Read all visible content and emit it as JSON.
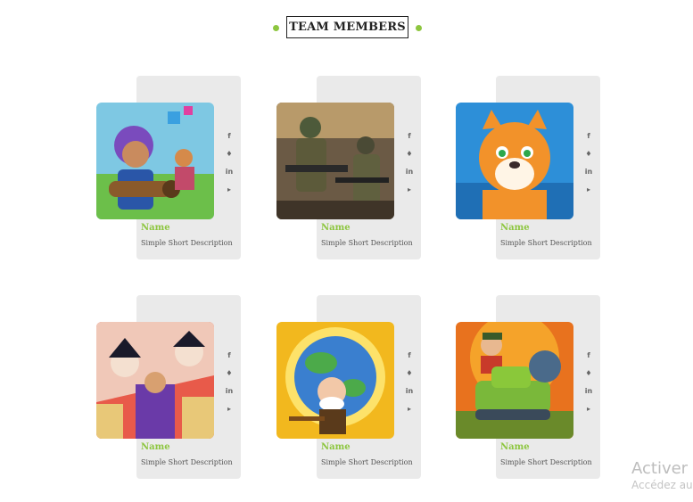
{
  "section": {
    "title": "TEAM MEMBERS"
  },
  "members": [
    {
      "name": "Name",
      "description": "Simple Short Description"
    },
    {
      "name": "Name",
      "description": "Simple Short Description"
    },
    {
      "name": "Name",
      "description": "Simple Short Description"
    },
    {
      "name": "Name",
      "description": "Simple Short Description"
    },
    {
      "name": "Name",
      "description": "Simple Short Description"
    },
    {
      "name": "Name",
      "description": "Simple Short Description"
    }
  ],
  "social": {
    "facebook": "f",
    "twitter": "♦",
    "linkedin": "in",
    "youtube": "▸"
  },
  "icons": [
    "facebook-icon",
    "twitter-icon",
    "linkedin-icon",
    "youtube-icon"
  ],
  "watermark": {
    "line1": "Activer Windows",
    "line2": "Accédez aux paramètres"
  },
  "colors": {
    "accent": "#8dc63f",
    "card_bg": "#eaeaea",
    "text": "#555555"
  }
}
